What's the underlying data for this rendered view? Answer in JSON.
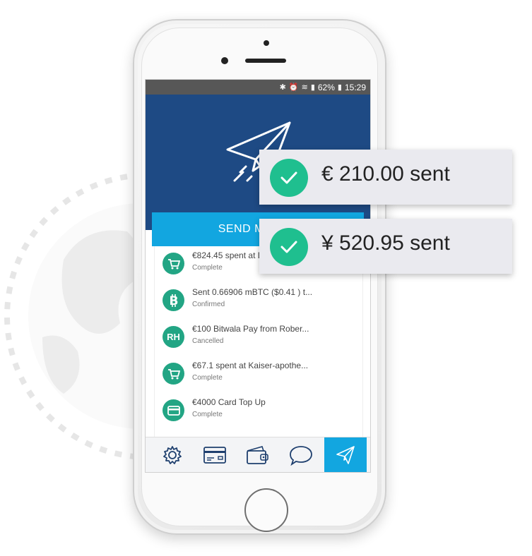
{
  "status_bar": {
    "icons": [
      "bluetooth-icon",
      "alarm-icon",
      "wifi-icon",
      "signal-icon"
    ],
    "battery": "62%",
    "time": "15:29"
  },
  "send_button": {
    "label": "SEND MONEY"
  },
  "transactions": [
    {
      "icon": "cart-icon",
      "initials": "",
      "title": "€824.45 spent at Dosenbach",
      "status": "Complete"
    },
    {
      "icon": "bitcoin-icon",
      "initials": "",
      "title": "Sent 0.66906 mBTC ($0.41 ) t...",
      "status": "Confirmed"
    },
    {
      "icon": "initials-avatar",
      "initials": "RH",
      "title": "€100 Bitwala Pay from Rober...",
      "status": "Cancelled"
    },
    {
      "icon": "cart-icon",
      "initials": "",
      "title": "€67.1 spent at Kaiser-apothe...",
      "status": "Complete"
    },
    {
      "icon": "card-icon",
      "initials": "",
      "title": "€4000 Card Top Up",
      "status": "Complete"
    }
  ],
  "tab_bar": [
    {
      "icon": "gear-icon",
      "active": false
    },
    {
      "icon": "card-icon",
      "active": false
    },
    {
      "icon": "wallet-icon",
      "active": false
    },
    {
      "icon": "chat-icon",
      "active": false
    },
    {
      "icon": "paper-plane-icon",
      "active": true
    }
  ],
  "notifications": [
    {
      "message": "€ 210.00 sent"
    },
    {
      "message": "¥ 520.95 sent"
    }
  ],
  "colors": {
    "hero": "#1e4a84",
    "accent": "#12a6e0",
    "success": "#1fbf8f",
    "badge": "#22a584"
  }
}
